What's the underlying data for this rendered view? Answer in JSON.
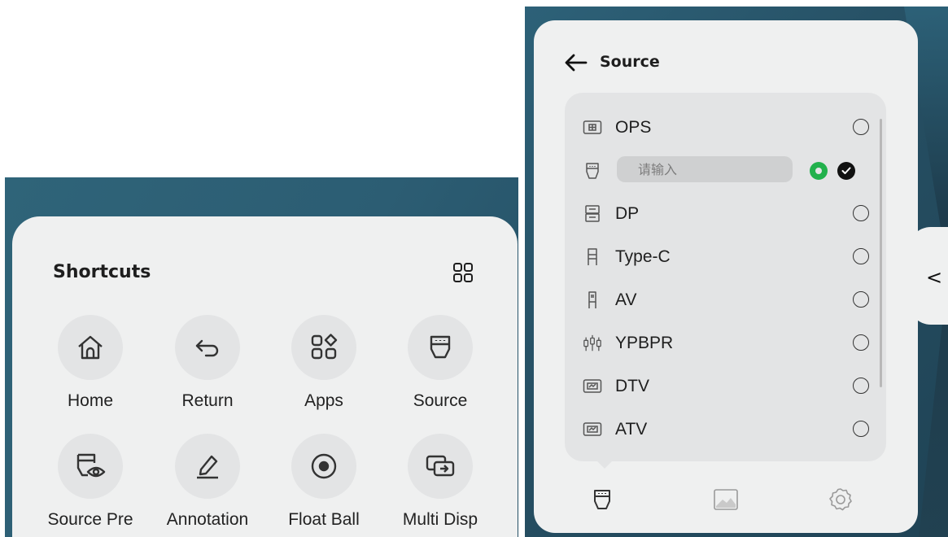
{
  "shortcuts": {
    "title": "Shortcuts",
    "tiles": [
      {
        "label": "Home",
        "icon": "home-icon"
      },
      {
        "label": "Return",
        "icon": "return-icon"
      },
      {
        "label": "Apps",
        "icon": "apps-icon"
      },
      {
        "label": "Source",
        "icon": "source-icon"
      },
      {
        "label": "Source Pre",
        "icon": "source-preview-icon"
      },
      {
        "label": "Annotation",
        "icon": "annotation-icon"
      },
      {
        "label": "Float Ball",
        "icon": "float-ball-icon"
      },
      {
        "label": "Multi Disp",
        "icon": "multi-display-icon"
      }
    ]
  },
  "source_panel": {
    "title": "Source",
    "rename_placeholder": "请输入",
    "items": [
      {
        "label": "OPS",
        "icon": "ops-icon",
        "selected": false
      },
      {
        "label": "",
        "icon": "hdmi-icon",
        "selected": true,
        "editing": true
      },
      {
        "label": "DP",
        "icon": "dp-icon",
        "selected": false
      },
      {
        "label": "Type-C",
        "icon": "type-c-icon",
        "selected": false
      },
      {
        "label": "AV",
        "icon": "av-icon",
        "selected": false
      },
      {
        "label": "YPBPR",
        "icon": "ypbpr-icon",
        "selected": false
      },
      {
        "label": "DTV",
        "icon": "dtv-icon",
        "selected": false
      },
      {
        "label": "ATV",
        "icon": "atv-icon",
        "selected": false
      }
    ],
    "tabs": [
      "source-tab-icon",
      "image-tab-icon",
      "settings-tab-icon"
    ]
  },
  "colors": {
    "background_teal": "#2c5d73",
    "card": "#eff0f0",
    "accent_green": "#22b14c"
  }
}
